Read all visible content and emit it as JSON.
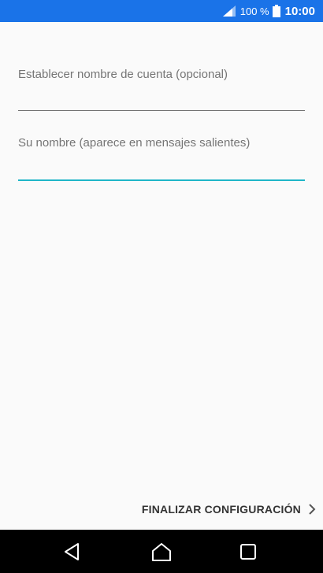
{
  "status_bar": {
    "battery_level": "100 %",
    "time": "10:00",
    "icons": [
      "signal-icon",
      "battery-icon"
    ],
    "bg_color": "#1a73e8"
  },
  "form": {
    "account_name_placeholder": "Establecer nombre de cuenta (opcional)",
    "your_name_placeholder": "Su nombre (aparece en mensajes salientes)",
    "account_name_value": "",
    "your_name_value": "",
    "focused_line_color": "#20b6c8"
  },
  "footer": {
    "finish_label": "FINALIZAR CONFIGURACIÓN",
    "chevron_icon": "chevron-right-icon"
  },
  "nav_bar": {
    "icons": [
      "back-icon",
      "home-icon",
      "recent-apps-icon"
    ]
  }
}
